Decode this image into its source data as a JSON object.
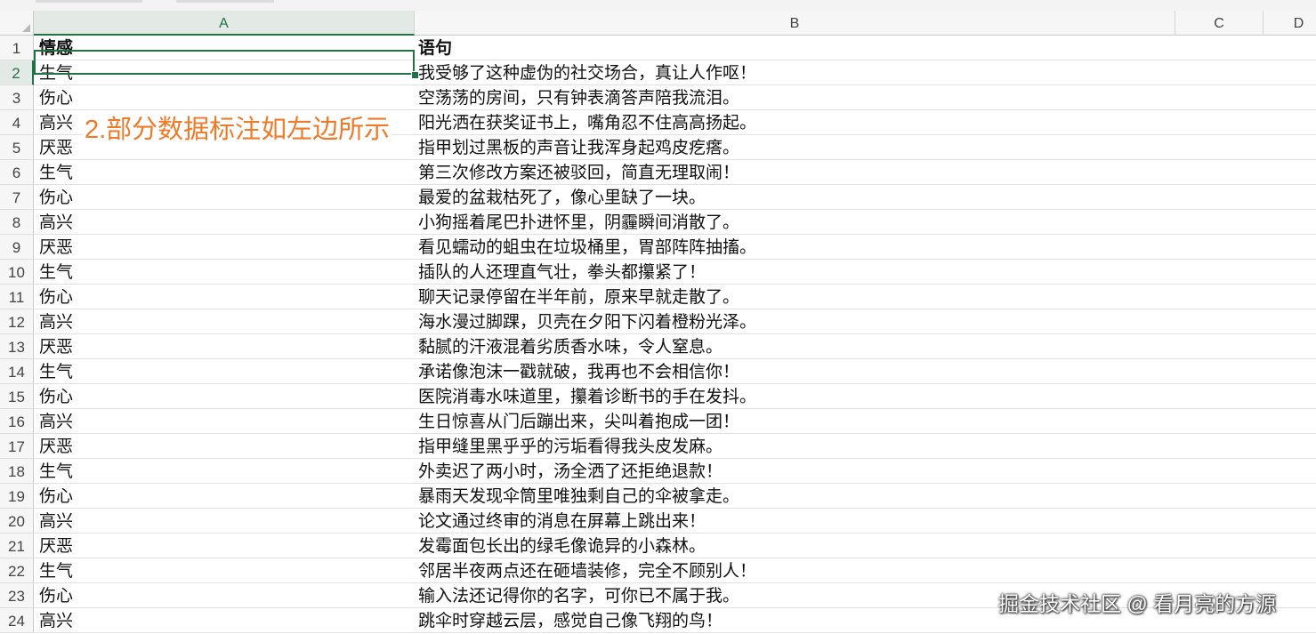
{
  "columns": [
    "A",
    "B",
    "C",
    "D"
  ],
  "headers": {
    "a": "情感",
    "b": "语句"
  },
  "rows": [
    {
      "num": "2",
      "a": "生气",
      "b": "我受够了这种虚伪的社交场合，真让人作呕！"
    },
    {
      "num": "3",
      "a": "伤心",
      "b": "空荡荡的房间，只有钟表滴答声陪我流泪。"
    },
    {
      "num": "4",
      "a": "高兴",
      "b": "阳光洒在获奖证书上，嘴角忍不住高高扬起。"
    },
    {
      "num": "5",
      "a": "厌恶",
      "b": "指甲划过黑板的声音让我浑身起鸡皮疙瘩。"
    },
    {
      "num": "6",
      "a": "生气",
      "b": "第三次修改方案还被驳回，简直无理取闹！"
    },
    {
      "num": "7",
      "a": "伤心",
      "b": "最爱的盆栽枯死了，像心里缺了一块。"
    },
    {
      "num": "8",
      "a": "高兴",
      "b": "小狗摇着尾巴扑进怀里，阴霾瞬间消散了。"
    },
    {
      "num": "9",
      "a": "厌恶",
      "b": "看见蠕动的蛆虫在垃圾桶里，胃部阵阵抽搐。"
    },
    {
      "num": "10",
      "a": "生气",
      "b": "插队的人还理直气壮，拳头都攥紧了！"
    },
    {
      "num": "11",
      "a": "伤心",
      "b": "聊天记录停留在半年前，原来早就走散了。"
    },
    {
      "num": "12",
      "a": "高兴",
      "b": "海水漫过脚踝，贝壳在夕阳下闪着橙粉光泽。"
    },
    {
      "num": "13",
      "a": "厌恶",
      "b": "黏腻的汗液混着劣质香水味，令人窒息。"
    },
    {
      "num": "14",
      "a": "生气",
      "b": "承诺像泡沫一戳就破，我再也不会相信你！"
    },
    {
      "num": "15",
      "a": "伤心",
      "b": "医院消毒水味道里，攥着诊断书的手在发抖。"
    },
    {
      "num": "16",
      "a": "高兴",
      "b": "生日惊喜从门后蹦出来，尖叫着抱成一团！"
    },
    {
      "num": "17",
      "a": "厌恶",
      "b": "指甲缝里黑乎乎的污垢看得我头皮发麻。"
    },
    {
      "num": "18",
      "a": "生气",
      "b": "外卖迟了两小时，汤全洒了还拒绝退款！"
    },
    {
      "num": "19",
      "a": "伤心",
      "b": "暴雨天发现伞筒里唯独剩自己的伞被拿走。"
    },
    {
      "num": "20",
      "a": "高兴",
      "b": "论文通过终审的消息在屏幕上跳出来！"
    },
    {
      "num": "21",
      "a": "厌恶",
      "b": "发霉面包长出的绿毛像诡异的小森林。"
    },
    {
      "num": "22",
      "a": "生气",
      "b": "邻居半夜两点还在砸墙装修，完全不顾别人！"
    },
    {
      "num": "23",
      "a": "伤心",
      "b": "输入法还记得你的名字，可你已不属于我。"
    },
    {
      "num": "24",
      "a": "高兴",
      "b": "跳伞时穿越云层，感觉自己像飞翔的鸟！"
    }
  ],
  "header_row_num": "1",
  "annotation": "2.部分数据标注如左边所示",
  "watermark": "掘金技术社区 @ 看月亮的方源",
  "colors": {
    "accent": "#217346",
    "annotation": "#f07a28"
  }
}
